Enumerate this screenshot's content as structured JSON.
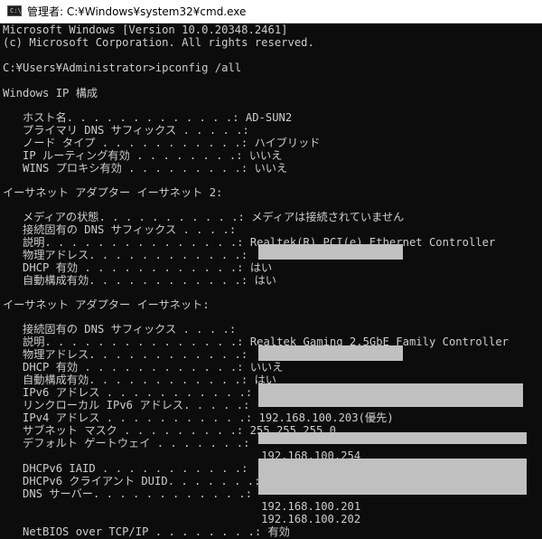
{
  "window": {
    "title": "管理者: C:¥Windows¥system32¥cmd.exe",
    "icon": "cmd-icon",
    "icon_text": "C:\\"
  },
  "console": {
    "header1": "Microsoft Windows [Version 10.0.20348.2461]",
    "header2": "(c) Microsoft Corporation. All rights reserved.",
    "prompt": "C:¥Users¥Administrator>ipconfig /all",
    "ip_config_title": "Windows IP 構成",
    "host_name": "   ホスト名. . . . . . . . . . . . .: AD-SUN2",
    "primary_dns_suffix": "   プライマリ DNS サフィックス . . . . .:",
    "node_type": "   ノード タイプ . . . . . . . . . . .: ハイブリッド",
    "ip_routing": "   IP ルーティング有効 . . . . . . . .: いいえ",
    "wins_proxy": "   WINS プロキシ有効 . . . . . . . . .: いいえ",
    "adapter2_title": "イーサネット アダプター イーサネット 2:",
    "a2_media_state": "   メディアの状態. . . . . . . . . . .: メディアは接続されていません",
    "a2_dns_suffix": "   接続固有の DNS サフィックス . . . .:",
    "a2_description": "   説明. . . . . . . . . . . . . . .: Realtek(R) PCI(e) Ethernet Controller",
    "a2_physical": "   物理アドレス. . . . . . . . . . . .:",
    "a2_dhcp": "   DHCP 有効 . . . . . . . . . . . .: はい",
    "a2_autoconfig": "   自動構成有効. . . . . . . . . . . .: はい",
    "adapter1_title": "イーサネット アダプター イーサネット:",
    "a1_dns_suffix": "   接続固有の DNS サフィックス . . . .:",
    "a1_description": "   説明. . . . . . . . . . . . . . .: Realtek Gaming 2.5GbE Family Controller",
    "a1_physical": "   物理アドレス. . . . . . . . . . . .:",
    "a1_dhcp": "   DHCP 有効 . . . . . . . . . . . .: いいえ",
    "a1_autoconfig": "   自動構成有効. . . . . . . . . . . .: はい",
    "a1_ipv6": "   IPv6 アドレス . . . . . . . . . . .:",
    "a1_linklocal": "   リンクローカル IPv6 アドレス. . . . .:",
    "a1_ipv4": "   IPv4 アドレス . . . . . . . . . . .: 192.168.100.203(優先)",
    "a1_subnet": "   サブネット マスク . . . . . . . . .: 255.255.255.0",
    "a1_gateway": "   デフォルト ゲートウェイ . . . . . . .:",
    "a1_gateway_v4": "                                       192.168.100.254",
    "a1_dhcpv6_iaid": "   DHCPv6 IAID . . . . . . . . . . .:",
    "a1_dhcpv6_duid": "   DHCPv6 クライアント DUID. . . . . . .:",
    "a1_dns_servers": "   DNS サーバー. . . . . . . . . . . .:",
    "a1_dns1": "                                       192.168.100.201",
    "a1_dns2": "                                       192.168.100.202",
    "a1_netbios": "   NetBIOS over TCP/IP . . . . . . . .: 有効"
  },
  "colors": {
    "background": "#0c0c0c",
    "text": "#cccccc",
    "redaction": "#c0c0c0",
    "titlebar": "#ffffff"
  }
}
